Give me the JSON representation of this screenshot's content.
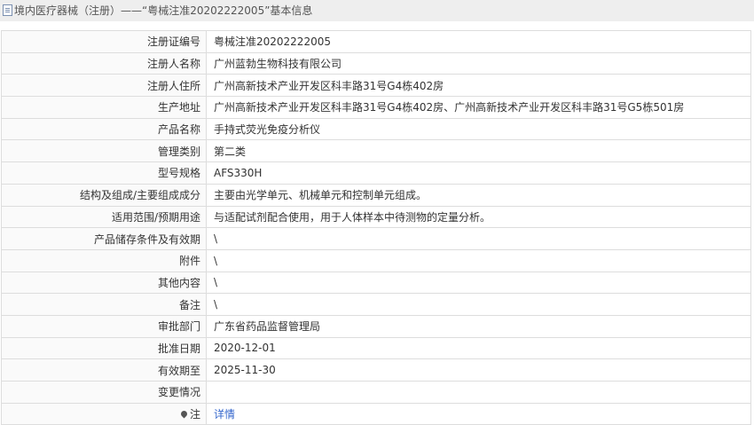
{
  "header": {
    "title": "境内医疗器械（注册）——“粤械注准20202222005”基本信息"
  },
  "rows": [
    {
      "label": "注册证编号",
      "value": "粤械注准20202222005"
    },
    {
      "label": "注册人名称",
      "value": "广州蓝勃生物科技有限公司"
    },
    {
      "label": "注册人住所",
      "value": "广州高新技术产业开发区科丰路31号G4栋402房"
    },
    {
      "label": "生产地址",
      "value": "广州高新技术产业开发区科丰路31号G4栋402房、广州高新技术产业开发区科丰路31号G5栋501房"
    },
    {
      "label": "产品名称",
      "value": "手持式荧光免疫分析仪"
    },
    {
      "label": "管理类别",
      "value": "第二类"
    },
    {
      "label": "型号规格",
      "value": "AFS330H"
    },
    {
      "label": "结构及组成/主要组成成分",
      "value": "主要由光学单元、机械单元和控制单元组成。"
    },
    {
      "label": "适用范围/预期用途",
      "value": "与适配试剂配合使用，用于人体样本中待测物的定量分析。"
    },
    {
      "label": "产品储存条件及有效期",
      "value": "\\"
    },
    {
      "label": "附件",
      "value": "\\"
    },
    {
      "label": "其他内容",
      "value": "\\"
    },
    {
      "label": "备注",
      "value": "\\"
    },
    {
      "label": "审批部门",
      "value": "广东省药品监督管理局"
    },
    {
      "label": "批准日期",
      "value": "2020-12-01"
    },
    {
      "label": "有效期至",
      "value": "2025-11-30"
    },
    {
      "label": "变更情况",
      "value": ""
    }
  ],
  "note_row": {
    "label": "注",
    "icon": "pin-icon",
    "link_text": "详情"
  }
}
